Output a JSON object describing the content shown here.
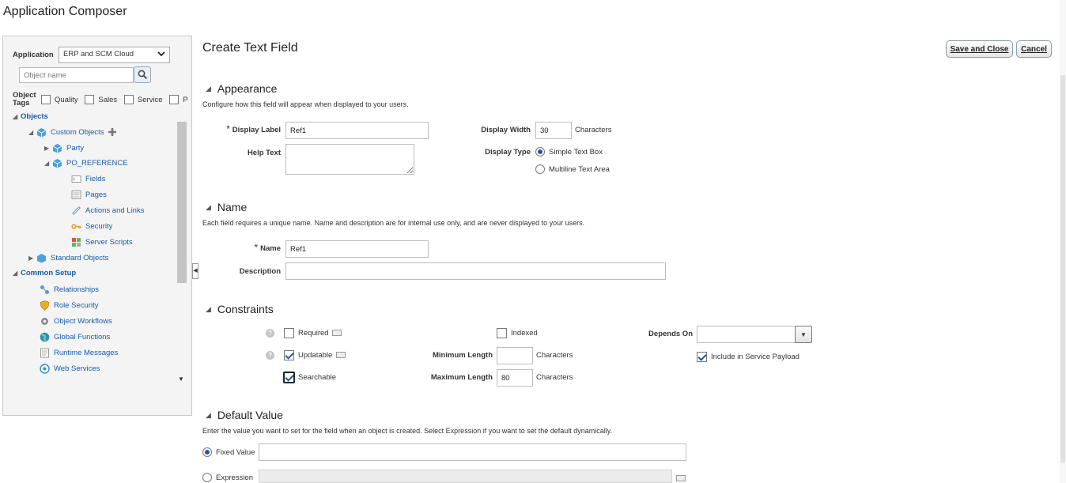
{
  "app": {
    "title": "Application Composer"
  },
  "left": {
    "application_label": "Application",
    "application_value": "ERP and SCM Cloud",
    "search_placeholder": "Object name",
    "tags_label": "Object Tags",
    "tags": [
      "Quality",
      "Sales",
      "Service",
      "PF"
    ],
    "tree": {
      "objects": "Objects",
      "custom_objects": "Custom Objects",
      "party": "Party",
      "po_reference": "PO_REFERENCE",
      "fields": "Fields",
      "pages": "Pages",
      "actions_links": "Actions and Links",
      "security": "Security",
      "server_scripts": "Server Scripts",
      "standard_objects": "Standard Objects",
      "common_setup": "Common Setup",
      "relationships": "Relationships",
      "role_security": "Role Security",
      "object_workflows": "Object Workflows",
      "global_functions": "Global Functions",
      "runtime_messages": "Runtime Messages",
      "web_services": "Web Services"
    }
  },
  "main": {
    "title": "Create Text Field",
    "save_close": "Save and Close",
    "cancel": "Cancel",
    "appearance": {
      "heading": "Appearance",
      "desc": "Configure how this field will appear when displayed to your users.",
      "display_label": "Display Label",
      "display_label_value": "Ref1",
      "help_text": "Help Text",
      "display_width": "Display Width",
      "display_width_value": "30",
      "characters": "Characters",
      "display_type": "Display Type",
      "simple_text_box": "Simple Text Box",
      "multiline": "Multiline Text Area"
    },
    "name": {
      "heading": "Name",
      "desc": "Each field requires a unique name. Name and description are for internal use only, and are never displayed to your users.",
      "name_label": "Name",
      "name_value": "Ref1",
      "description_label": "Description"
    },
    "constraints": {
      "heading": "Constraints",
      "required": "Required",
      "updatable": "Updatable",
      "searchable": "Searchable",
      "indexed": "Indexed",
      "min_length": "Minimum Length",
      "max_length": "Maximum Length",
      "max_length_value": "80",
      "characters": "Characters",
      "depends_on": "Depends On",
      "include_payload": "Include in Service Payload"
    },
    "default_value": {
      "heading": "Default Value",
      "desc": "Enter the value you want to set for the field when an object is created. Select Expression if you want to set the default dynamically.",
      "fixed_value": "Fixed Value",
      "expression": "Expression"
    }
  },
  "colors": {
    "link": "#1a5aa6",
    "panel_bg": "#f4f4f4",
    "border": "#c9c9c9"
  }
}
